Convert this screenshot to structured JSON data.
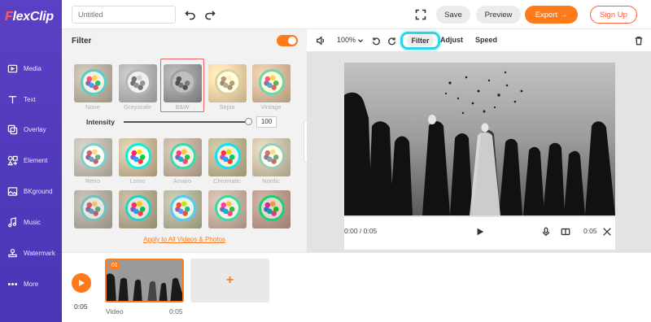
{
  "app": {
    "logo_text": "lexClip",
    "logo_f": "F"
  },
  "sidebar": {
    "items": [
      {
        "label": "Media",
        "icon": "media-icon"
      },
      {
        "label": "Text",
        "icon": "text-icon"
      },
      {
        "label": "Overlay",
        "icon": "overlay-icon"
      },
      {
        "label": "Element",
        "icon": "element-icon"
      },
      {
        "label": "BKground",
        "icon": "background-icon"
      },
      {
        "label": "Music",
        "icon": "music-icon"
      },
      {
        "label": "Watermark",
        "icon": "watermark-icon"
      },
      {
        "label": "More",
        "icon": "more-icon"
      }
    ]
  },
  "topbar": {
    "title_placeholder": "Untitled",
    "save_label": "Save",
    "preview_label": "Preview",
    "export_label": "Export →",
    "signup_label": "Sign Up"
  },
  "filter_panel": {
    "title": "Filter",
    "enabled": true,
    "selected": "B&W",
    "row1_labels": [
      "None",
      "Greyscale",
      "B&W",
      "Sepia",
      "Vintage"
    ],
    "row2_labels": [
      "Retro",
      "Lomo",
      "Amaro",
      "Chromatic",
      "Nordic"
    ],
    "intensity_label": "Intensity",
    "intensity_value": "100",
    "apply_all": "Apply to All Videos & Photos"
  },
  "editor_toolbar": {
    "zoom": "100%",
    "tabs": {
      "filter": "Filter",
      "adjust": "Adjust",
      "speed": "Speed"
    }
  },
  "player": {
    "current_time": "0:00 / 0:05",
    "duration": "0:05",
    "progress": 0
  },
  "timeline": {
    "time": "0:05",
    "clip_badge": "01",
    "clip_label": "Video",
    "clip_duration": "0:05",
    "add_symbol": "+"
  },
  "colors": {
    "accent": "#ff7a1a",
    "sidebar": "#4a35b5",
    "highlight": "#2fd4e8",
    "selection": "#f06060"
  }
}
